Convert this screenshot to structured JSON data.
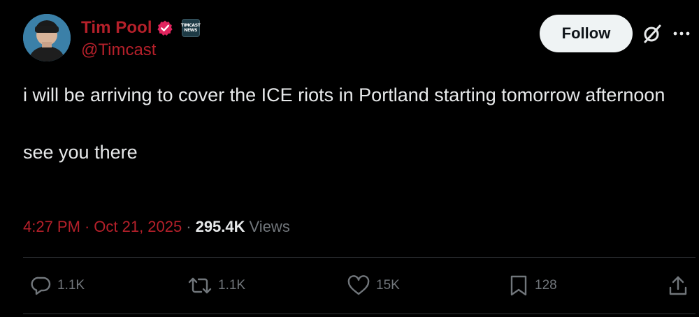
{
  "author": {
    "display_name": "Tim Pool",
    "handle": "@Timcast",
    "verified_badge_color": "#f91880",
    "affiliate_badge_lines": [
      "TIMCAST",
      "NEWS"
    ]
  },
  "header": {
    "follow_label": "Follow"
  },
  "tweet": {
    "line1": "i will be arriving to cover the ICE riots in Portland starting tomorrow afternoon",
    "line2": "see you there"
  },
  "meta": {
    "time": "4:27 PM",
    "date": "Oct 21, 2025",
    "separator": "·",
    "views_count": "295.4K",
    "views_label": "Views"
  },
  "actions": {
    "replies": "1.1K",
    "reposts": "1.1K",
    "likes": "15K",
    "bookmarks": "128"
  },
  "icons": {
    "verified": "verified-badge-icon",
    "grok": "grok-icon",
    "more": "more-icon",
    "reply": "reply-icon",
    "repost": "repost-icon",
    "like": "heart-icon",
    "bookmark": "bookmark-icon",
    "share": "share-icon"
  },
  "colors": {
    "background": "#000000",
    "accent_red": "#b5202a",
    "text_primary": "#e7e9ea",
    "text_secondary": "#71767b",
    "follow_bg": "#eff3f4"
  }
}
